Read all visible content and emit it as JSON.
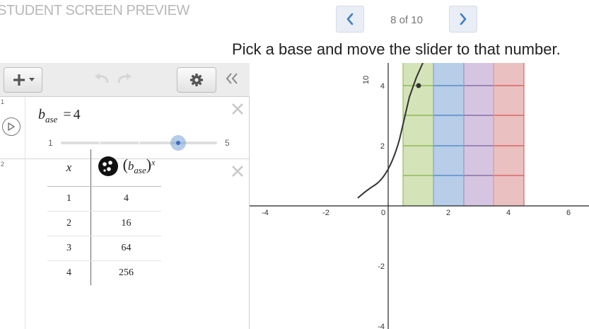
{
  "header": {
    "title": "STUDENT SCREEN PREVIEW",
    "page_indicator": "8 of 10",
    "instruction": "Pick a base and move the slider to that number."
  },
  "expressions": [
    {
      "number": "1",
      "variable_main": "b",
      "variable_sub": "ase",
      "equals": "=",
      "value": "4",
      "slider": {
        "min_label": "1",
        "max_label": "5",
        "min": 1,
        "max": 5,
        "value": 4
      }
    },
    {
      "number": "2",
      "table": {
        "header_x": "x",
        "header_y_main": "b",
        "header_y_sub": "ase",
        "header_y_exp": "x",
        "rows": [
          {
            "x": "1",
            "y": "4"
          },
          {
            "x": "2",
            "y": "16"
          },
          {
            "x": "3",
            "y": "64"
          },
          {
            "x": "4",
            "y": "256"
          }
        ]
      }
    }
  ],
  "graph": {
    "x_tick_labels": [
      "-4",
      "-2",
      "0",
      "2",
      "4",
      "6"
    ],
    "y_tick_labels": [
      "4",
      "2",
      "-2",
      "-4"
    ],
    "rotated_label": "10",
    "colors": {
      "green_fill": "#d5e3b9",
      "green_line": "#8fbd57",
      "blue_fill": "#b7cde8",
      "blue_line": "#5a8bc9",
      "purple_fill": "#d5c5e0",
      "purple_line": "#8a6fa8",
      "red_fill": "#ebc0c0",
      "red_line": "#d86565",
      "curve": "#333333"
    }
  }
}
